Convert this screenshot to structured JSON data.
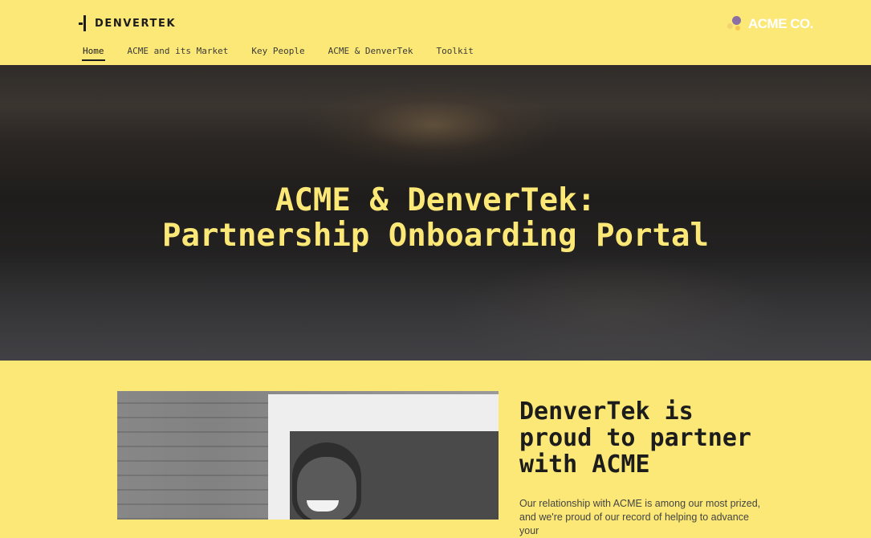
{
  "header": {
    "brand": "DENVERTEK",
    "partner_logo": "ACME CO.",
    "nav": [
      {
        "label": "Home",
        "active": true
      },
      {
        "label": "ACME and its Market"
      },
      {
        "label": "Key People"
      },
      {
        "label": "ACME & DenverTek"
      },
      {
        "label": "Toolkit"
      }
    ]
  },
  "hero": {
    "title_line1": "ACME & DenverTek:",
    "title_line2": "Partnership Onboarding Portal"
  },
  "intro": {
    "heading_line1": "DenverTek is",
    "heading_line2": "proud to partner",
    "heading_line3": "with ACME",
    "body": "Our relationship with ACME is among our most prized, and we're proud of our record of helping to advance your"
  },
  "colors": {
    "background": "#fbe877",
    "text": "#1c1c1c",
    "accent_purple": "#8b6ea3"
  },
  "icons": [
    "denvertek-logo-icon",
    "acme-logo-icon"
  ]
}
